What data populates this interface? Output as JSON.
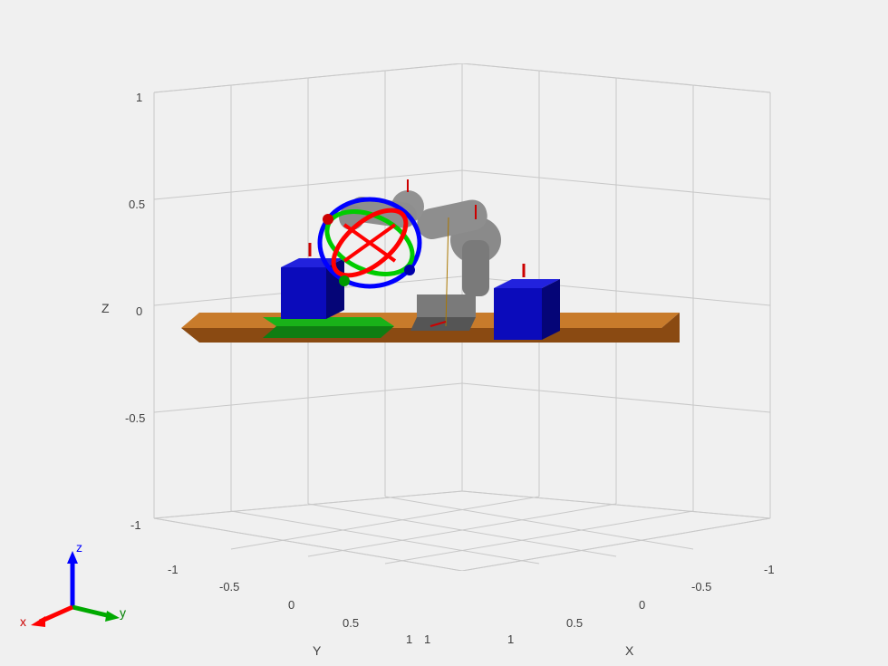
{
  "axes": {
    "x": {
      "label": "X",
      "ticks": [
        "-1",
        "-0.5",
        "0",
        "0.5",
        "1"
      ]
    },
    "y": {
      "label": "Y",
      "ticks": [
        "-1",
        "-0.5",
        "0",
        "0.5",
        "1",
        "1"
      ]
    },
    "z": {
      "label": "Z",
      "ticks": [
        "-1",
        "-0.5",
        "0",
        "0.5",
        "1"
      ]
    }
  },
  "orient": {
    "x": "x",
    "y": "y",
    "z": "z"
  },
  "scene": {
    "ground_color": "#c87b2b",
    "ground_side_color": "#8a4a12",
    "robot_color": "#808080",
    "boxes": [
      {
        "name": "box-left",
        "color": "#0b0bbb"
      },
      {
        "name": "box-right",
        "color": "#0b0bbb"
      }
    ],
    "slab": {
      "name": "green-slab",
      "color": "#19b219"
    },
    "orbit_circles": [
      {
        "name": "orbit-blue",
        "color": "#0000ff"
      },
      {
        "name": "orbit-red",
        "color": "#ff0000"
      },
      {
        "name": "orbit-green",
        "color": "#00cc00"
      }
    ]
  },
  "chart_data": {
    "type": "table",
    "title": "3D robot arm simulation scene",
    "axes": {
      "x": {
        "label": "X",
        "range": [
          -1,
          1
        ],
        "ticks": [
          -1,
          -0.5,
          0,
          0.5,
          1
        ]
      },
      "y": {
        "label": "Y",
        "range": [
          -1,
          1
        ],
        "ticks": [
          -1,
          -0.5,
          0,
          0.5,
          1,
          1
        ]
      },
      "z": {
        "label": "Z",
        "range": [
          -1,
          1
        ],
        "ticks": [
          -1,
          -0.5,
          0,
          0.5,
          1
        ]
      }
    },
    "objects": [
      {
        "name": "ground-plate",
        "type": "box",
        "color": "#c87b2b",
        "center": [
          0.0,
          0.0,
          0.0
        ],
        "size": [
          1.1,
          1.4,
          0.05
        ]
      },
      {
        "name": "green-slab",
        "type": "box",
        "color": "#19b219",
        "center": [
          0.25,
          0.25,
          0.03
        ],
        "size": [
          0.25,
          0.35,
          0.04
        ]
      },
      {
        "name": "box-left",
        "type": "box",
        "color": "#0b0bbb",
        "center": [
          -0.15,
          -0.35,
          0.08
        ],
        "size": [
          0.15,
          0.15,
          0.15
        ]
      },
      {
        "name": "box-right",
        "type": "box",
        "color": "#0b0bbb",
        "center": [
          0.3,
          -0.25,
          0.08
        ],
        "size": [
          0.15,
          0.15,
          0.15
        ]
      },
      {
        "name": "robot-arm",
        "type": "robot",
        "color": "#808080",
        "base": [
          0.0,
          0.0,
          0.0
        ],
        "end_effector": [
          0.2,
          -0.15,
          0.2
        ],
        "reach_height": 0.45
      },
      {
        "name": "rotation-gizmo",
        "type": "orbit-handles",
        "center": [
          0.2,
          -0.15,
          0.2
        ],
        "radius": 0.15,
        "circles": [
          {
            "axis": "x",
            "color": "#ff0000"
          },
          {
            "axis": "y",
            "color": "#00cc00"
          },
          {
            "axis": "z",
            "color": "#0000ff"
          }
        ]
      }
    ],
    "orientation_widget": {
      "x_color": "#ff0000",
      "y_color": "#00aa00",
      "z_color": "#0000ff"
    }
  }
}
